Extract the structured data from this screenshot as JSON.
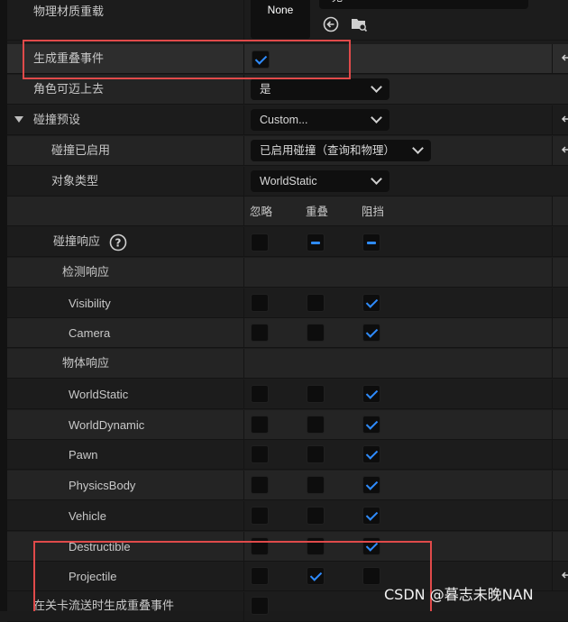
{
  "physics_override": {
    "label": "物理材质重载",
    "value": "None",
    "top_combo_value": "无"
  },
  "generate_overlap": {
    "label": "生成重叠事件",
    "checked": true
  },
  "can_step_up": {
    "label": "角色可迈上去",
    "value": "是"
  },
  "collision_preset": {
    "label": "碰撞预设",
    "value": "Custom..."
  },
  "collision_enabled": {
    "label": "碰撞已启用",
    "value": "已启用碰撞（查询和物理）"
  },
  "object_type": {
    "label": "对象类型",
    "value": "WorldStatic"
  },
  "columns": {
    "ignore": "忽略",
    "overlap": "重叠",
    "block": "阻挡"
  },
  "collision_responses": {
    "label": "碰撞响应",
    "help": "?"
  },
  "trace_responses": {
    "label": "检测响应"
  },
  "object_responses": {
    "label": "物体响应"
  },
  "channels": [
    {
      "name": "Visibility",
      "state": "block"
    },
    {
      "name": "Camera",
      "state": "block"
    },
    {
      "name": "WorldStatic",
      "state": "block"
    },
    {
      "name": "WorldDynamic",
      "state": "block"
    },
    {
      "name": "Pawn",
      "state": "block"
    },
    {
      "name": "PhysicsBody",
      "state": "block"
    },
    {
      "name": "Vehicle",
      "state": "block"
    },
    {
      "name": "Destructible",
      "state": "block"
    },
    {
      "name": "Projectile",
      "state": "overlap"
    }
  ],
  "level_streaming_overlap": {
    "label": "在关卡流送时生成重叠事件",
    "checked": false
  },
  "watermark": "CSDN @暮志未晚NAN",
  "colors": {
    "accent": "#2f8cff",
    "highlight_box": "#e04a4a",
    "background": "#1c1c1c"
  }
}
